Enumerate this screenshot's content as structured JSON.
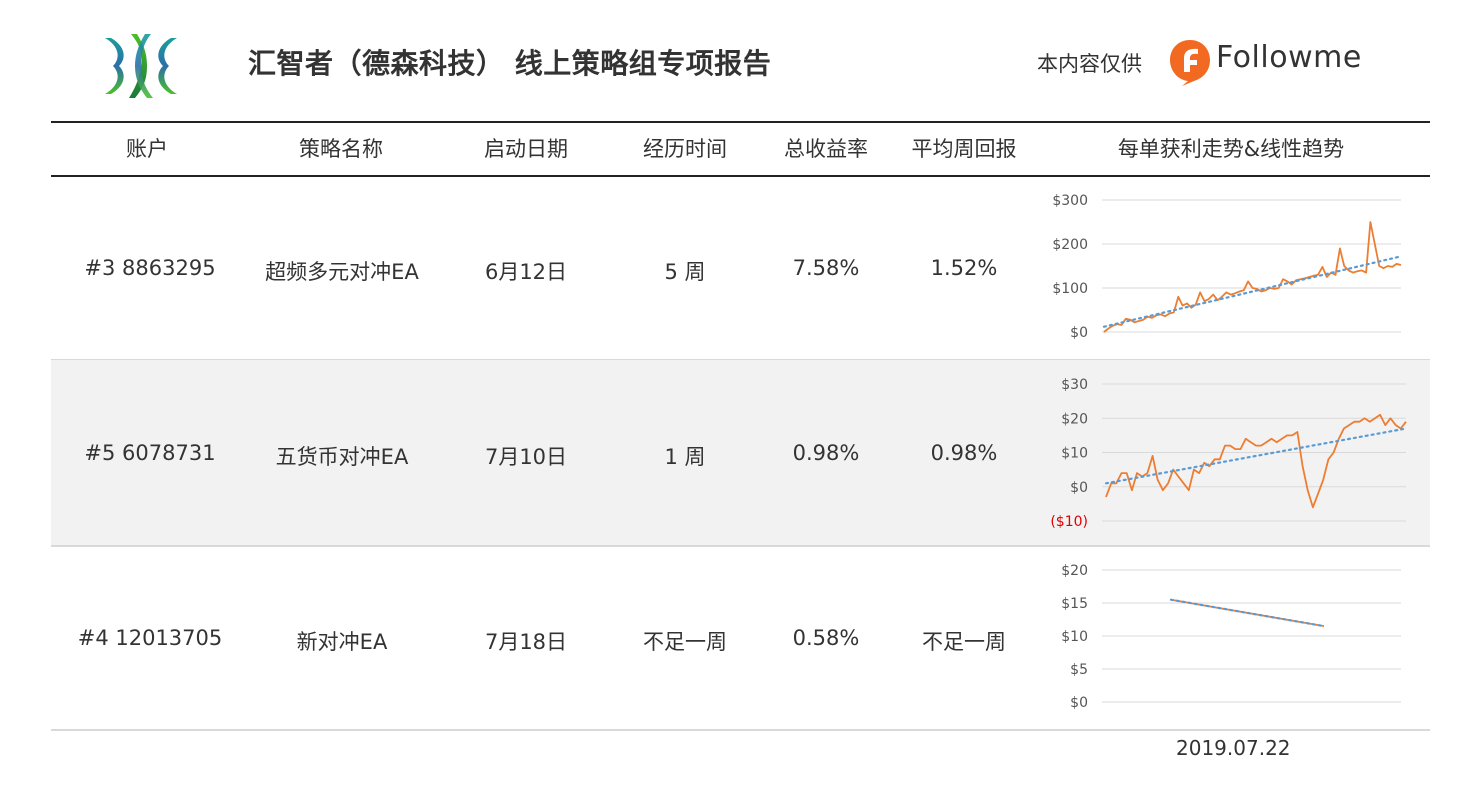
{
  "header": {
    "title": "汇智者（德森科技） 线上策略组专项报告",
    "sponsor_text": "本内容仅供",
    "brand": "Followme",
    "brand_color": "#f26a21"
  },
  "table": {
    "columns": [
      "账户",
      "策略名称",
      "启动日期",
      "经历时间",
      "总收益率",
      "平均周回报",
      "每单获利走势&线性趋势"
    ],
    "rows": [
      {
        "account": "#3 8863295",
        "strategy": "超频多元对冲EA",
        "start": "6月12日",
        "duration": "5 周",
        "total_return": "7.58%",
        "weekly_return": "1.52%"
      },
      {
        "account": "#5 6078731",
        "strategy": "五货币对冲EA",
        "start": "7月10日",
        "duration": "1 周",
        "total_return": "0.98%",
        "weekly_return": "0.98%"
      },
      {
        "account": "#4 12013705",
        "strategy": "新对冲EA",
        "start": "7月18日",
        "duration": "不足一周",
        "total_return": "0.58%",
        "weekly_return": "不足一周"
      }
    ]
  },
  "footer": {
    "date": "2019.07.22"
  },
  "colors": {
    "series": "#ed7d31",
    "trend": "#5b9bd5",
    "negative_label": "#e00000",
    "grid": "#d9d9d9"
  },
  "chart_data": [
    {
      "type": "line",
      "yticks": [
        "$300",
        "$200",
        "$100",
        "$0"
      ],
      "ylim": [
        0,
        300
      ],
      "grid": true,
      "series": [
        {
          "values": [
            0,
            8,
            14,
            18,
            16,
            30,
            28,
            22,
            25,
            28,
            35,
            32,
            38,
            40,
            36,
            42,
            45,
            80,
            60,
            65,
            55,
            62,
            90,
            70,
            75,
            85,
            72,
            80,
            90,
            85,
            88,
            92,
            95,
            115,
            100,
            98,
            92,
            95,
            100,
            98,
            100,
            120,
            115,
            108,
            118,
            120,
            122,
            125,
            128,
            130,
            148,
            125,
            135,
            130,
            190,
            150,
            140,
            135,
            138,
            140,
            135,
            250,
            200,
            150,
            145,
            150,
            148,
            155,
            152
          ]
        }
      ],
      "trend": [
        12,
        172
      ]
    },
    {
      "type": "line",
      "yticks": [
        "$30",
        "$20",
        "$10",
        "$0",
        "($10)"
      ],
      "ylim": [
        -10,
        30
      ],
      "grid": true,
      "series": [
        {
          "values": [
            -3,
            1,
            1,
            4,
            4,
            -1,
            4,
            3,
            4,
            9,
            2,
            -1,
            1,
            5,
            3,
            1,
            -1,
            5,
            4,
            7,
            6,
            8,
            8,
            12,
            12,
            11,
            11,
            14,
            13,
            12,
            12,
            13,
            14,
            13,
            14,
            15,
            15,
            16,
            6,
            -1,
            -6,
            -2,
            2,
            8,
            10,
            14,
            17,
            18,
            19,
            19,
            20,
            19,
            20,
            21,
            18,
            20,
            18,
            17,
            19
          ]
        }
      ],
      "trend": [
        1,
        17
      ]
    },
    {
      "type": "line",
      "yticks": [
        "$20",
        "$15",
        "$10",
        "$5",
        "$0"
      ],
      "ylim": [
        0,
        20
      ],
      "grid": true,
      "series": [
        {
          "values": [
            15.5,
            11.5
          ]
        }
      ],
      "trend": [
        15.5,
        11.5
      ]
    }
  ]
}
